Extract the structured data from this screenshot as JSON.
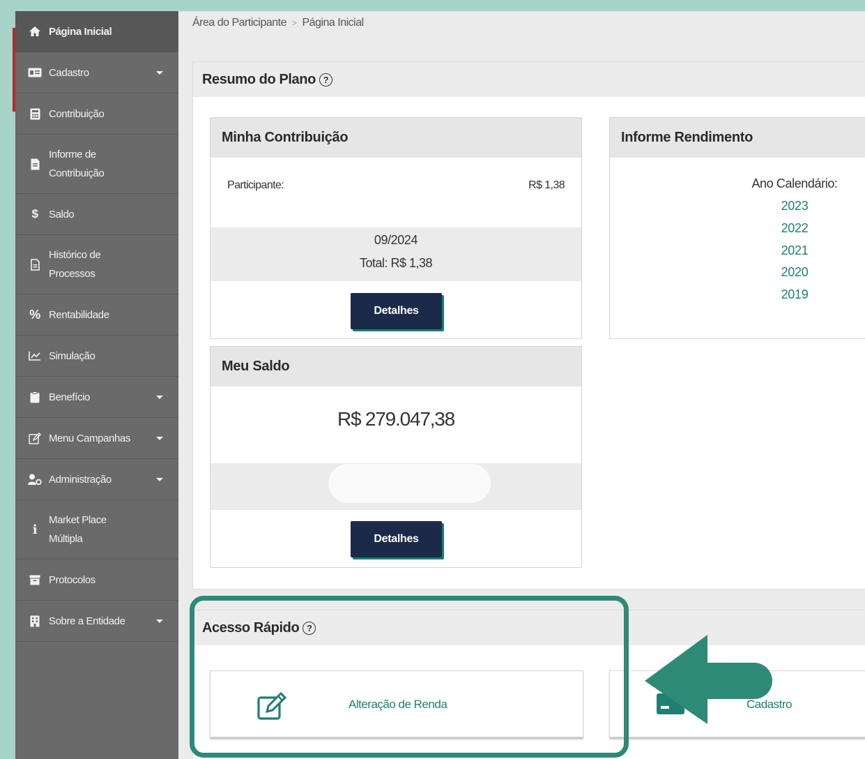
{
  "sidebar": {
    "items": [
      {
        "label": "Página Inicial",
        "icon": "home-icon"
      },
      {
        "label": "Cadastro",
        "icon": "id-card-icon"
      },
      {
        "label": "Contribuição",
        "icon": "calculator-icon"
      },
      {
        "label": "Informe de Contribuição",
        "icon": "document-icon"
      },
      {
        "label": "Saldo",
        "icon": "dollar-icon"
      },
      {
        "label": "Histórico de Processos",
        "icon": "file-icon"
      },
      {
        "label": "Rentabilidade",
        "icon": "percent-icon"
      },
      {
        "label": "Simulação",
        "icon": "chart-line-icon"
      },
      {
        "label": "Benefício",
        "icon": "clipboard-icon"
      },
      {
        "label": "Menu Campanhas",
        "icon": "edit-icon"
      },
      {
        "label": "Administração",
        "icon": "user-cog-icon"
      },
      {
        "label": "Market Place Múltipla",
        "icon": "info-icon"
      },
      {
        "label": "Protocolos",
        "icon": "archive-icon"
      },
      {
        "label": "Sobre a Entidade",
        "icon": "building-icon"
      }
    ]
  },
  "breadcrumb": {
    "root": "Área do Participante",
    "separator": ">",
    "current": "Página Inicial"
  },
  "resumo": {
    "title": "Resumo do Plano",
    "minha_contribuicao": {
      "title": "Minha Contribuição",
      "participante_label": "Participante:",
      "participante_value": "R$ 1,38",
      "period": "09/2024",
      "total": "Total: R$ 1,38",
      "button": "Detalhes"
    },
    "informe": {
      "title": "Informe Rendimento",
      "ano_label": "Ano Calendário:",
      "years": [
        "2023",
        "2022",
        "2021",
        "2020",
        "2019"
      ]
    },
    "meu_saldo": {
      "title": "Meu Saldo",
      "value": "R$ 279.047,38",
      "button": "Detalhes"
    }
  },
  "acesso_rapido": {
    "title": "Acesso Rápido",
    "items": [
      {
        "label": "Alteração de Renda",
        "icon": "edit-icon"
      },
      {
        "label": "Cadastro",
        "icon": "id-card-icon"
      }
    ]
  },
  "colors": {
    "sidebar": "#6a6a6a",
    "accent_green": "#2c8a77",
    "link_green": "#1f7f73",
    "button_navy": "#1c2a4a"
  }
}
